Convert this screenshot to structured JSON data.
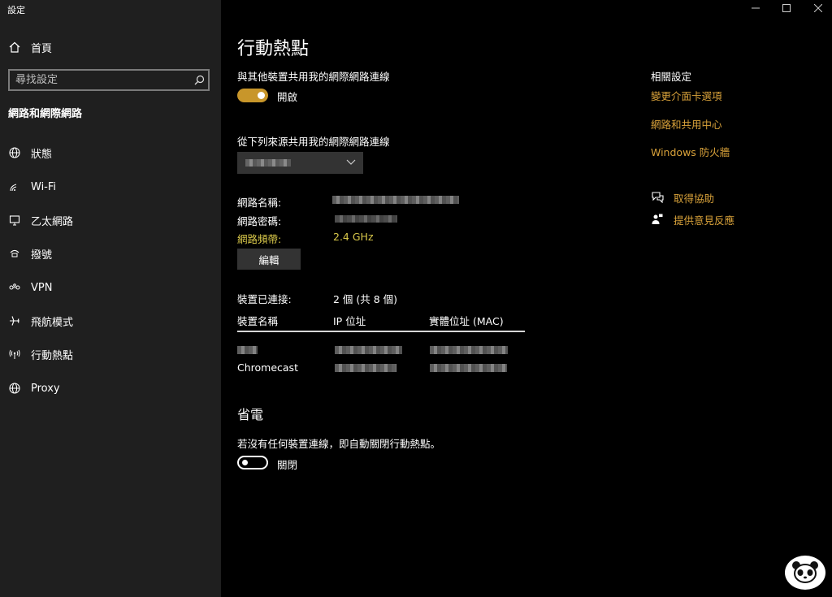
{
  "window": {
    "title": "設定"
  },
  "sidebar": {
    "home_label": "首頁",
    "search_placeholder": "尋找設定",
    "section_title": "網路和網際網路",
    "items": [
      {
        "label": "狀態",
        "icon": "globe-icon"
      },
      {
        "label": "Wi-Fi",
        "icon": "wifi-icon"
      },
      {
        "label": "乙太網路",
        "icon": "ethernet-icon"
      },
      {
        "label": "撥號",
        "icon": "dialup-icon"
      },
      {
        "label": "VPN",
        "icon": "vpn-icon"
      },
      {
        "label": "飛航模式",
        "icon": "airplane-icon"
      },
      {
        "label": "行動熱點",
        "icon": "hotspot-icon"
      },
      {
        "label": "Proxy",
        "icon": "globe-icon"
      }
    ]
  },
  "main": {
    "title": "行動熱點",
    "share_label": "與其他裝置共用我的網際網路連線",
    "share_toggle_state": "開啟",
    "share_from_label": "從下列來源共用我的網際網路連線",
    "network_name_label": "網路名稱:",
    "network_password_label": "網路密碼:",
    "network_band_label": "網路頻帶:",
    "network_band_value": "2.4 GHz",
    "edit_button": "編輯",
    "devices_connected_label": "裝置已連接:",
    "devices_connected_value": "2 個 (共 8 個)",
    "table": {
      "headers": [
        "裝置名稱",
        "IP 位址",
        "實體位址 (MAC)"
      ],
      "rows": [
        {
          "name": ""
        },
        {
          "name": "Chromecast"
        }
      ]
    },
    "power_saving_title": "省電",
    "power_saving_desc": "若沒有任何裝置連線，即自動關閉行動熱點。",
    "power_toggle_state": "關閉"
  },
  "related": {
    "title": "相關設定",
    "links": [
      "變更介面卡選項",
      "網路和共用中心",
      "Windows 防火牆"
    ],
    "help": "取得協助",
    "feedback": "提供意見反應"
  },
  "colors": {
    "accent": "#c8962a",
    "link": "#d9a23a",
    "band_highlight": "#d9c84a",
    "sidebar_bg": "#1f1f1f"
  }
}
